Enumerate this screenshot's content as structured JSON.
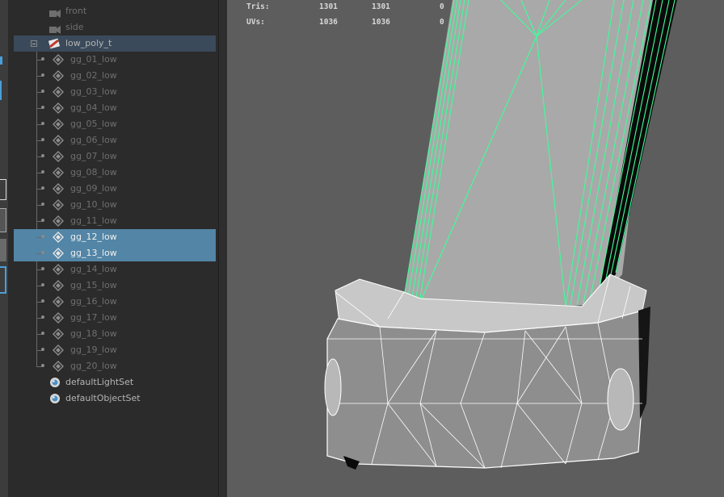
{
  "outliner": {
    "items": [
      {
        "label": "front",
        "kind": "camera",
        "dim": true
      },
      {
        "label": "side",
        "kind": "camera",
        "dim": true
      },
      {
        "label": "low_poly_t",
        "kind": "group"
      },
      {
        "label": "gg_01_low",
        "kind": "mesh",
        "dim": true
      },
      {
        "label": "gg_02_low",
        "kind": "mesh",
        "dim": true
      },
      {
        "label": "gg_03_low",
        "kind": "mesh",
        "dim": true
      },
      {
        "label": "gg_04_low",
        "kind": "mesh",
        "dim": true
      },
      {
        "label": "gg_05_low",
        "kind": "mesh",
        "dim": true
      },
      {
        "label": "gg_06_low",
        "kind": "mesh",
        "dim": true
      },
      {
        "label": "gg_07_low",
        "kind": "mesh",
        "dim": true
      },
      {
        "label": "gg_08_low",
        "kind": "mesh",
        "dim": true
      },
      {
        "label": "gg_09_low",
        "kind": "mesh",
        "dim": true
      },
      {
        "label": "gg_10_low",
        "kind": "mesh",
        "dim": true
      },
      {
        "label": "gg_11_low",
        "kind": "mesh",
        "dim": true
      },
      {
        "label": "gg_12_low",
        "kind": "mesh",
        "selected": true
      },
      {
        "label": "gg_13_low",
        "kind": "mesh",
        "selected": true
      },
      {
        "label": "gg_14_low",
        "kind": "mesh",
        "dim": true
      },
      {
        "label": "gg_15_low",
        "kind": "mesh",
        "dim": true
      },
      {
        "label": "gg_16_low",
        "kind": "mesh",
        "dim": true
      },
      {
        "label": "gg_17_low",
        "kind": "mesh",
        "dim": true
      },
      {
        "label": "gg_18_low",
        "kind": "mesh",
        "dim": true
      },
      {
        "label": "gg_19_low",
        "kind": "mesh",
        "dim": true
      },
      {
        "label": "gg_20_low",
        "kind": "mesh",
        "dim": true
      },
      {
        "label": "defaultLightSet",
        "kind": "set"
      },
      {
        "label": "defaultObjectSet",
        "kind": "set"
      }
    ]
  },
  "hud": {
    "tris_label": "Tris:",
    "tris_a": "1301",
    "tris_b": "1301",
    "tris_c": "0",
    "uvs_label": "UVs:",
    "uvs_a": "1036",
    "uvs_b": "1036",
    "uvs_c": "0"
  },
  "colors": {
    "selection": "#5285a6",
    "wireframe_selected": "#3cff9a",
    "wireframe": "#ffffff"
  }
}
